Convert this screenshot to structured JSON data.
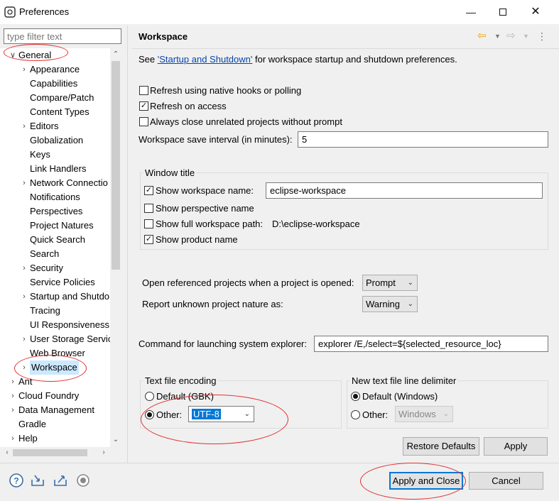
{
  "window": {
    "title": "Preferences",
    "minimize_icon": "minimize-icon",
    "maximize_icon": "maximize-icon",
    "close_icon": "close-icon"
  },
  "filter": {
    "placeholder": "type filter text",
    "value": ""
  },
  "tree": {
    "general": "General",
    "general_children": [
      {
        "label": "Appearance",
        "expandable": true
      },
      {
        "label": "Capabilities",
        "expandable": false
      },
      {
        "label": "Compare/Patch",
        "expandable": false
      },
      {
        "label": "Content Types",
        "expandable": false
      },
      {
        "label": "Editors",
        "expandable": true
      },
      {
        "label": "Globalization",
        "expandable": false
      },
      {
        "label": "Keys",
        "expandable": false
      },
      {
        "label": "Link Handlers",
        "expandable": false
      },
      {
        "label": "Network Connectio",
        "expandable": true
      },
      {
        "label": "Notifications",
        "expandable": false
      },
      {
        "label": "Perspectives",
        "expandable": false
      },
      {
        "label": "Project Natures",
        "expandable": false
      },
      {
        "label": "Quick Search",
        "expandable": false
      },
      {
        "label": "Search",
        "expandable": false
      },
      {
        "label": "Security",
        "expandable": true
      },
      {
        "label": "Service Policies",
        "expandable": false
      },
      {
        "label": "Startup and Shutdo",
        "expandable": true
      },
      {
        "label": "Tracing",
        "expandable": false
      },
      {
        "label": "UI Responsiveness",
        "expandable": false
      },
      {
        "label": "User Storage Servic",
        "expandable": true
      },
      {
        "label": "Web Browser",
        "expandable": false
      },
      {
        "label": "Workspace",
        "expandable": true,
        "selected": true
      }
    ],
    "top_items": [
      {
        "label": "Ant",
        "expandable": true
      },
      {
        "label": "Cloud Foundry",
        "expandable": true
      },
      {
        "label": "Data Management",
        "expandable": true
      },
      {
        "label": "Gradle",
        "expandable": false
      },
      {
        "label": "Help",
        "expandable": true
      }
    ]
  },
  "page": {
    "title": "Workspace",
    "see_prefix": "See ",
    "see_link": "'Startup and Shutdown'",
    "see_suffix": " for workspace startup and shutdown preferences.",
    "refresh_native": {
      "label": "Refresh using native hooks or polling",
      "checked": false
    },
    "refresh_access": {
      "label": "Refresh on access",
      "checked": true
    },
    "close_unrelated": {
      "label": "Always close unrelated projects without prompt",
      "checked": false
    },
    "save_interval_label": "Workspace save interval (in minutes):",
    "save_interval_value": "5",
    "window_title_group": "Window title",
    "show_ws_name": {
      "label": "Show workspace name:",
      "checked": true,
      "value": "eclipse-workspace"
    },
    "show_persp": {
      "label": "Show perspective name",
      "checked": false
    },
    "show_full_path": {
      "label": "Show full workspace path:",
      "checked": false,
      "value": "D:\\eclipse-workspace"
    },
    "show_product": {
      "label": "Show product name",
      "checked": true
    },
    "open_ref_label": "Open referenced projects when a project is opened:",
    "open_ref_value": "Prompt",
    "report_label": "Report unknown project nature as:",
    "report_value": "Warning",
    "cmd_label": "Command for launching system explorer:",
    "cmd_value": "explorer /E,/select=${selected_resource_loc}",
    "encoding_group": "Text file encoding",
    "enc_default": "Default (GBK)",
    "enc_other": "Other:",
    "enc_value": "UTF-8",
    "delim_group": "New text file line delimiter",
    "delim_default": "Default (Windows)",
    "delim_other": "Other:",
    "delim_value": "Windows",
    "restore_defaults": "Restore Defaults",
    "apply": "Apply"
  },
  "footer": {
    "apply_close": "Apply and Close",
    "cancel": "Cancel",
    "icons": [
      "help-icon",
      "import-icon",
      "export-icon",
      "record-icon"
    ]
  },
  "colors": {
    "annotation": "#e03030",
    "link": "#0645ad",
    "selection": "#cce8ff",
    "accent": "#0078d7"
  }
}
